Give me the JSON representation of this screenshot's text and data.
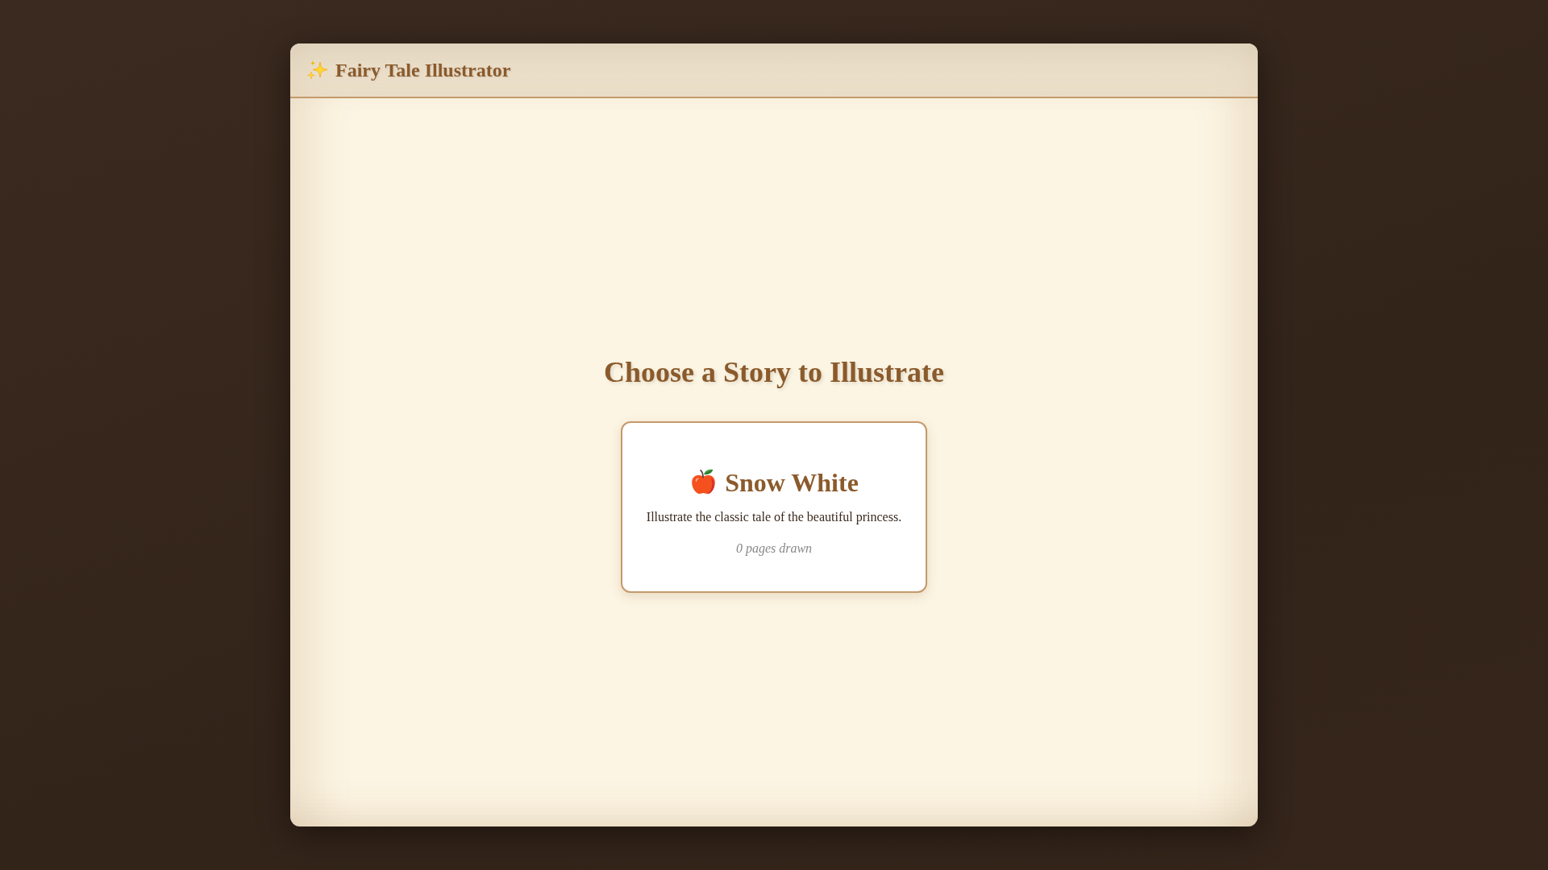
{
  "app": {
    "title": "Fairy Tale Illustrator"
  },
  "heading": "Choose a Story to Illustrate",
  "stories": [
    {
      "title": "Snow White",
      "description": "Illustrate the classic tale of the beautiful princess.",
      "progress": "0 pages drawn"
    }
  ]
}
